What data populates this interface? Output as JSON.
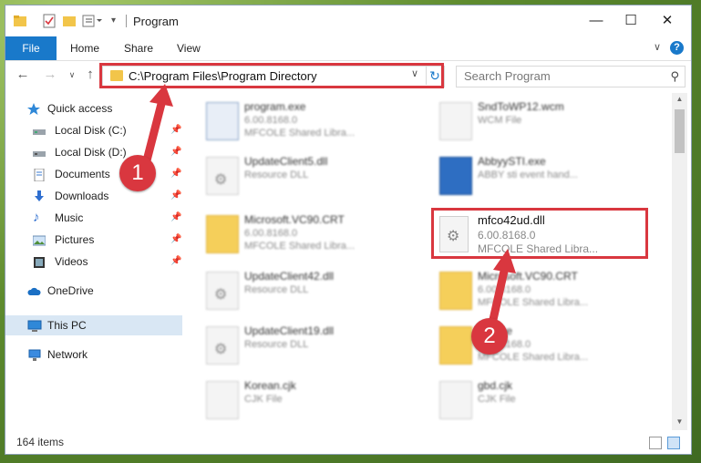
{
  "window": {
    "title": "Program",
    "ribbon_tabs": [
      "File",
      "Home",
      "Share",
      "View"
    ]
  },
  "nav": {
    "address": "C:\\Program Files\\Program Directory",
    "search_placeholder": "Search Program"
  },
  "sidebar": {
    "items": [
      {
        "label": "Quick access",
        "icon": "star-icon"
      },
      {
        "label": "Local Disk (C:)",
        "icon": "drive-icon"
      },
      {
        "label": "Local Disk (D:)",
        "icon": "drive-icon"
      },
      {
        "label": "Documents",
        "icon": "documents-icon"
      },
      {
        "label": "Downloads",
        "icon": "downloads-icon"
      },
      {
        "label": "Music",
        "icon": "music-icon"
      },
      {
        "label": "Pictures",
        "icon": "pictures-icon"
      },
      {
        "label": "Videos",
        "icon": "videos-icon"
      },
      {
        "label": "OneDrive",
        "icon": "onedrive-icon"
      },
      {
        "label": "This PC",
        "icon": "pc-icon"
      },
      {
        "label": "Network",
        "icon": "network-icon"
      }
    ]
  },
  "files": [
    {
      "name": "program.exe",
      "line2": "6.00.8168.0",
      "line3": "MFCOLE Shared Libra..."
    },
    {
      "name": "SndToWP12.wcm",
      "line2": "WCM File",
      "line3": ""
    },
    {
      "name": "UpdateClient5.dll",
      "line2": "Resource DLL",
      "line3": ""
    },
    {
      "name": "AbbyySTI.exe",
      "line2": "ABBY sti event hand...",
      "line3": ""
    },
    {
      "name": "Microsoft.VC90.CRT",
      "line2": "6.00.8168.0",
      "line3": "MFCOLE Shared Libra..."
    },
    {
      "name": "UpdateClient42.dll",
      "line2": "Resource DLL",
      "line3": ""
    },
    {
      "name": "Microsoft.VC90.CRT",
      "line2": "6.00.8168.0",
      "line3": "MFCOLE Shared Libra..."
    },
    {
      "name": "UpdateClient19.dll",
      "line2": "Resource DLL",
      "line3": ""
    },
    {
      "name": "Source",
      "line2": "6.00.8168.0",
      "line3": "MFCOLE Shared Libra..."
    },
    {
      "name": "Korean.cjk",
      "line2": "CJK File",
      "line3": ""
    },
    {
      "name": "gbd.cjk",
      "line2": "CJK File",
      "line3": ""
    }
  ],
  "highlighted_file": {
    "name": "mfco42ud.dll",
    "version": "6.00.8168.0",
    "description": "MFCOLE Shared Libra..."
  },
  "status": {
    "items_count": "164 items"
  },
  "callouts": [
    "1",
    "2"
  ],
  "colors": {
    "accent": "#1979ca",
    "callout_red": "#d9373f"
  }
}
